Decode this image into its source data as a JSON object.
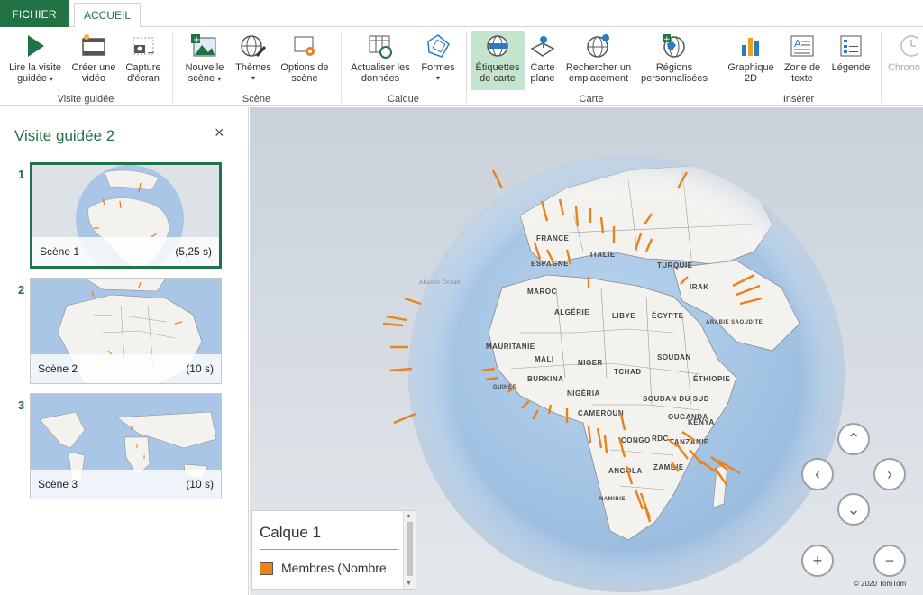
{
  "tabs": {
    "file": "FICHIER",
    "home": "ACCUEIL"
  },
  "ribbon": {
    "groups": {
      "tour": "Visite guidée",
      "scene": "Scène",
      "layer": "Calque",
      "map": "Carte",
      "insert": "Insérer"
    },
    "buttons": {
      "play_tour": [
        "Lire la visite",
        "guidée"
      ],
      "create_video": [
        "Créer une",
        "vidéo"
      ],
      "capture": [
        "Capture",
        "d'écran"
      ],
      "new_scene": [
        "Nouvelle",
        "scène"
      ],
      "themes": [
        "Thèmes",
        ""
      ],
      "scene_options": [
        "Options de",
        "scène"
      ],
      "refresh": [
        "Actualiser les",
        "données"
      ],
      "shapes": [
        "Formes",
        ""
      ],
      "map_labels": [
        "Étiquettes",
        "de carte"
      ],
      "flat_map": [
        "Carte",
        "plane"
      ],
      "find_location": [
        "Rechercher un",
        "emplacement"
      ],
      "custom_regions": [
        "Régions",
        "personnalisées"
      ],
      "chart_2d": [
        "Graphique",
        "2D"
      ],
      "text_box": [
        "Zone de",
        "texte"
      ],
      "legend": [
        "Légende",
        ""
      ],
      "timeline": [
        "Chrono",
        ""
      ]
    }
  },
  "panel": {
    "title": "Visite guidée 2",
    "close_glyph": "×",
    "scenes": [
      {
        "number": "1",
        "name": "Scène 1",
        "duration": "(5,25 s)"
      },
      {
        "number": "2",
        "name": "Scène 2",
        "duration": "(10 s)"
      },
      {
        "number": "3",
        "name": "Scène 3",
        "duration": "(10 s)"
      }
    ]
  },
  "map": {
    "country_labels": [
      "FRANCE",
      "ESPAGNE",
      "ITALIE",
      "TURQUIE",
      "MAROC",
      "IRAK",
      "ALGÉRIE",
      "LIBYE",
      "ÉGYPTE",
      "ARABIE SAOUDITE",
      "MAURITANIE",
      "MALI",
      "NIGER",
      "TCHAD",
      "SOUDAN",
      "BURKINA",
      "GUINÉE",
      "NIGÉRIA",
      "SOUDAN DU SUD",
      "ÉTHIOPIE",
      "CAMEROUN",
      "OUGANDA",
      "KENYA",
      "CONGO",
      "RDC",
      "TANZANIE",
      "ANGOLA",
      "ZAMBIE",
      "NAMIBIE",
      "Atlantic Ocean"
    ],
    "legend_title": "Calque 1",
    "legend_series": "Membres (Nombre",
    "copyright": "© 2020 TomTom",
    "nav": {
      "up": "⌃",
      "down": "⌄",
      "left": "‹",
      "right": "›",
      "zoom_in": "+",
      "zoom_out": "−"
    }
  },
  "colors": {
    "accent": "#217346",
    "bar": "#e8821d",
    "ocean": "#a9c6e6",
    "land": "#f3f2ee"
  }
}
